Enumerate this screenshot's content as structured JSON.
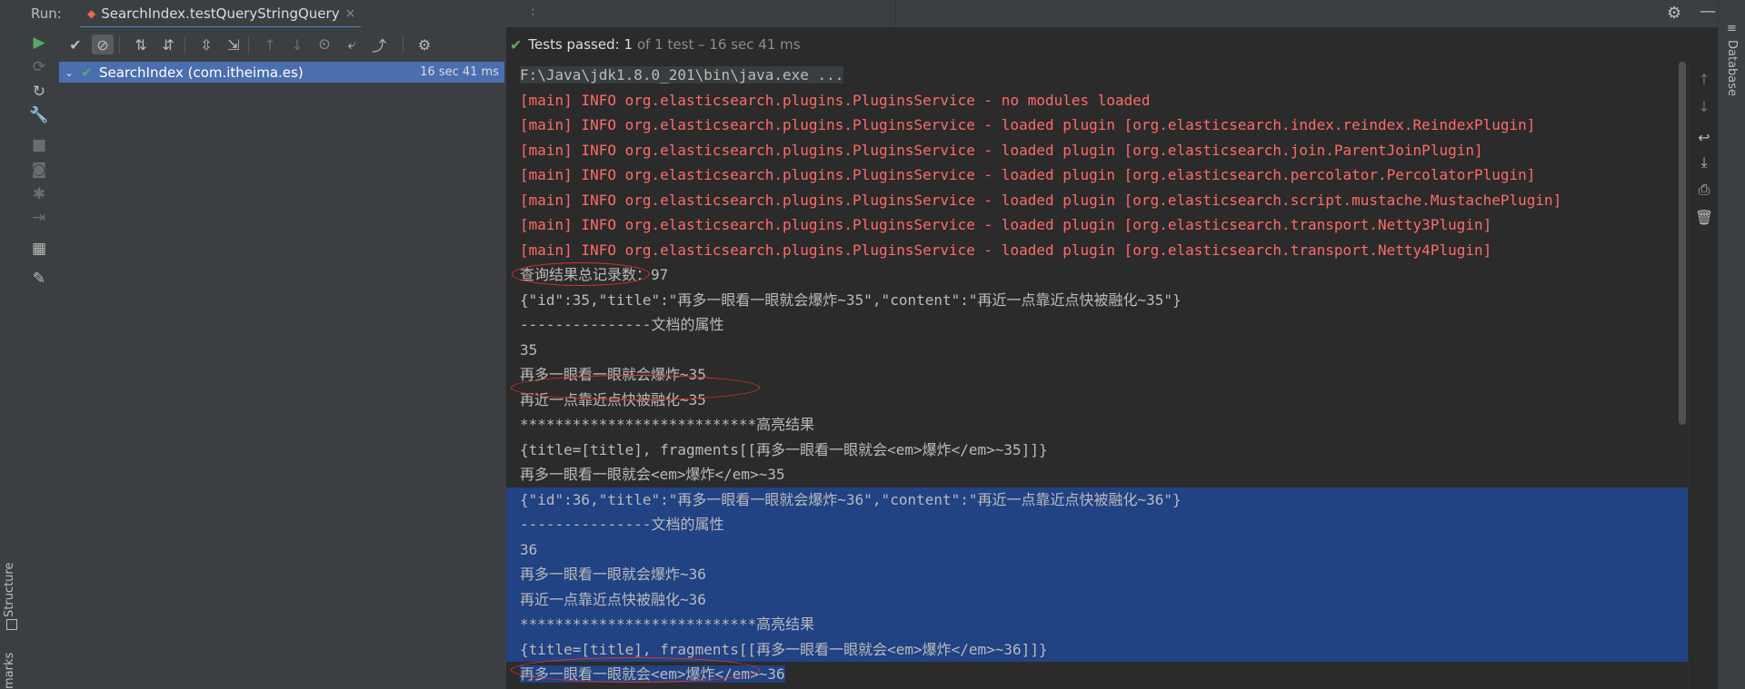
{
  "left_strip": {
    "structure_label": "Structure",
    "bookmarks_label": "marks"
  },
  "header": {
    "run_label": "Run:",
    "tab_title": "SearchIndex.testQueryStringQuery",
    "tab_close": "×",
    "overflow": ":"
  },
  "icons": {
    "settings": "⚙",
    "minimize": "—"
  },
  "toolbar_left": [
    {
      "name": "rerun-icon",
      "glyph": "▶",
      "color": "#59a869"
    },
    {
      "name": "rerun-failed-icon",
      "glyph": "⟳",
      "dim": true
    },
    {
      "name": "toggle-autotest-icon",
      "glyph": "↻"
    },
    {
      "name": "settings-wrench-icon",
      "glyph": "🔧"
    },
    {
      "name": "stop-icon",
      "glyph": "■",
      "dim": true
    },
    {
      "name": "camera-icon",
      "glyph": "◙",
      "dim": true
    },
    {
      "name": "debug-icon",
      "glyph": "✱",
      "dim": true
    },
    {
      "name": "exit-icon",
      "glyph": "⇥",
      "dim": true
    },
    {
      "name": "layout-icon",
      "glyph": "▦"
    },
    {
      "name": "pin-icon",
      "glyph": "✎"
    }
  ],
  "toolbar_top": [
    {
      "name": "show-passed-icon",
      "glyph": "✔"
    },
    {
      "name": "show-ignored-icon",
      "glyph": "⊘",
      "active": true
    },
    {
      "name": "sort-alpha-icon",
      "glyph": "⇅"
    },
    {
      "name": "sort-duration-icon",
      "glyph": "⇵"
    },
    {
      "name": "expand-all-icon",
      "glyph": "⇳"
    },
    {
      "name": "collapse-all-icon",
      "glyph": "⇲"
    },
    {
      "name": "prev-failed-icon",
      "glyph": "↑",
      "dim": true
    },
    {
      "name": "next-failed-icon",
      "glyph": "↓",
      "dim": true
    },
    {
      "name": "history-icon",
      "glyph": "⏲"
    },
    {
      "name": "import-tests-icon",
      "glyph": "⤶"
    },
    {
      "name": "export-tests-icon",
      "glyph": "⤴"
    },
    {
      "name": "toolbar-settings-icon",
      "glyph": "⚙"
    }
  ],
  "status": {
    "passed": "Tests passed: 1",
    "detail": "of 1 test – 16 sec 41 ms"
  },
  "tree": {
    "item_label": "SearchIndex (com.itheima.es)",
    "item_time": "16 sec 41 ms"
  },
  "console_lines": [
    {
      "text": "F:\\Java\\jdk1.8.0_201\\bin\\java.exe ...",
      "style": "cmd"
    },
    {
      "text": "[main] INFO org.elasticsearch.plugins.PluginsService - no modules loaded",
      "style": "red"
    },
    {
      "text": "[main] INFO org.elasticsearch.plugins.PluginsService - loaded plugin [org.elasticsearch.index.reindex.ReindexPlugin]",
      "style": "red"
    },
    {
      "text": "[main] INFO org.elasticsearch.plugins.PluginsService - loaded plugin [org.elasticsearch.join.ParentJoinPlugin]",
      "style": "red"
    },
    {
      "text": "[main] INFO org.elasticsearch.plugins.PluginsService - loaded plugin [org.elasticsearch.percolator.PercolatorPlugin]",
      "style": "red"
    },
    {
      "text": "[main] INFO org.elasticsearch.plugins.PluginsService - loaded plugin [org.elasticsearch.script.mustache.MustachePlugin]",
      "style": "red"
    },
    {
      "text": "[main] INFO org.elasticsearch.plugins.PluginsService - loaded plugin [org.elasticsearch.transport.Netty3Plugin]",
      "style": "red"
    },
    {
      "text": "[main] INFO org.elasticsearch.plugins.PluginsService - loaded plugin [org.elasticsearch.transport.Netty4Plugin]",
      "style": "red"
    },
    {
      "text": "查询结果总记录数：97",
      "style": "gray"
    },
    {
      "text": "{\"id\":35,\"title\":\"再多一眼看一眼就会爆炸~35\",\"content\":\"再近一点靠近点快被融化~35\"}",
      "style": "gray"
    },
    {
      "text": "---------------文档的属性",
      "style": "gray"
    },
    {
      "text": "35",
      "style": "gray"
    },
    {
      "text": "再多一眼看一眼就会爆炸~35",
      "style": "gray"
    },
    {
      "text": "再近一点靠近点快被融化~35",
      "style": "gray"
    },
    {
      "text": "***************************高亮结果",
      "style": "gray"
    },
    {
      "text": "{title=[title], fragments[[再多一眼看一眼就会<em>爆炸</em>~35]]}",
      "style": "gray"
    },
    {
      "text": "再多一眼看一眼就会<em>爆炸</em>~35",
      "style": "gray"
    },
    {
      "text": "{\"id\":36,\"title\":\"再多一眼看一眼就会爆炸~36\",\"content\":\"再近一点靠近点快被融化~36\"}",
      "style": "sel"
    },
    {
      "text": "---------------文档的属性",
      "style": "sel"
    },
    {
      "text": "36",
      "style": "sel"
    },
    {
      "text": "再多一眼看一眼就会爆炸~36",
      "style": "sel"
    },
    {
      "text": "再近一点靠近点快被融化~36",
      "style": "sel"
    },
    {
      "text": "***************************高亮结果",
      "style": "sel"
    },
    {
      "text": "{title=[title], fragments[[再多一眼看一眼就会<em>爆炸</em>~36]]}",
      "style": "sel"
    },
    {
      "text": "再多一眼看一眼就会<em>爆炸</em>~36",
      "style": "selpart"
    }
  ],
  "right_tools": [
    {
      "name": "scroll-up-icon",
      "glyph": "↑",
      "dim": true
    },
    {
      "name": "scroll-down-icon",
      "glyph": "↓",
      "dim": true
    },
    {
      "name": "soft-wrap-icon",
      "glyph": "↩"
    },
    {
      "name": "scroll-to-end-icon",
      "glyph": "⤓"
    },
    {
      "name": "print-icon",
      "glyph": "⎙"
    },
    {
      "name": "clear-icon",
      "glyph": "🗑"
    }
  ],
  "right_strip": {
    "database_label": "Database",
    "database_icon": "≡"
  },
  "colors": {
    "accent_selection": "#4b6eaf",
    "console_selection": "#214283",
    "error_text": "#ff6b68",
    "success": "#59a869",
    "annotation": "#e0322a"
  }
}
